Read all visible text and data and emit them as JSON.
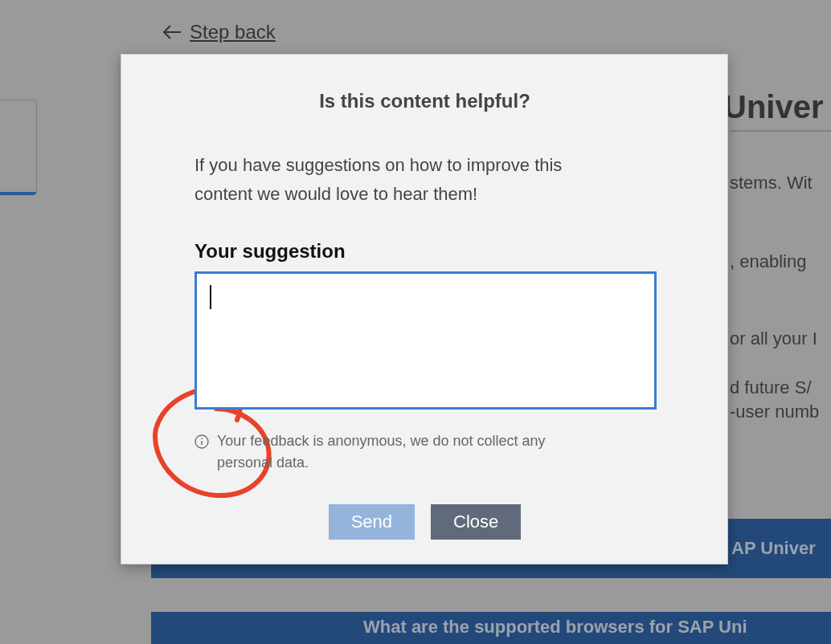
{
  "back_link": {
    "label": "Step back"
  },
  "background": {
    "heading": "Univer",
    "fragments": [
      "stems. Wit",
      ", enabling",
      "or all your I",
      "d future S/",
      "-user numb"
    ],
    "bars": [
      "AP Univer",
      "What are the supported browsers for SAP Uni"
    ]
  },
  "dialog": {
    "title": "Is this content helpful?",
    "intro": "If you have suggestions on how to improve this content we would love to hear them!",
    "field_label": "Your suggestion",
    "field": {
      "focused": true
    },
    "note": "Your feedback is anonymous, we do not collect any personal data.",
    "buttons": [
      {
        "label": "Send",
        "kind": "primary",
        "disabled": true
      },
      {
        "label": "Close",
        "kind": "secondary",
        "disabled": false
      }
    ]
  }
}
